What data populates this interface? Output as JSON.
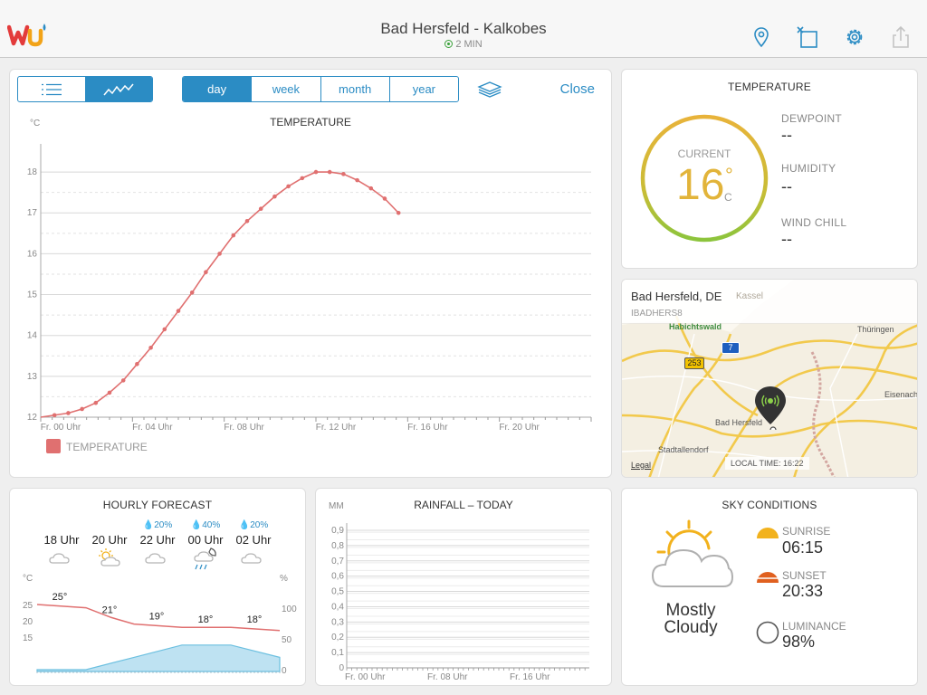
{
  "header": {
    "title": "Bad Hersfeld - Kalkobes",
    "updated": "2 MIN"
  },
  "toolbar": {
    "range_tabs": [
      "day",
      "week",
      "month",
      "year"
    ],
    "close_label": "Close"
  },
  "temperature_chart": {
    "title": "TEMPERATURE",
    "unit": "°C",
    "legend": "TEMPERATURE",
    "y_ticks": [
      "12",
      "13",
      "14",
      "15",
      "16",
      "17",
      "18"
    ],
    "x_ticks": [
      "Fr. 00 Uhr",
      "Fr. 04 Uhr",
      "Fr. 08 Uhr",
      "Fr. 12 Uhr",
      "Fr. 16 Uhr",
      "Fr. 20 Uhr"
    ],
    "color": "#e07070"
  },
  "chart_data": [
    {
      "type": "line",
      "title": "TEMPERATURE",
      "ylabel": "°C",
      "xlabel": "",
      "ylim": [
        12,
        18.6
      ],
      "xlim": [
        0,
        24
      ],
      "grid": true,
      "legend": "bottom-left",
      "series": [
        {
          "name": "TEMPERATURE",
          "x": [
            0.6,
            1.2,
            1.8,
            2.4,
            3.0,
            3.6,
            4.2,
            4.8,
            5.4,
            6.0,
            6.6,
            7.2,
            7.8,
            8.4,
            9.0,
            9.6,
            10.2,
            10.8,
            11.4,
            12.0,
            12.6,
            13.2,
            13.8,
            14.4,
            15.0,
            15.6
          ],
          "y": [
            12.05,
            12.1,
            12.2,
            12.35,
            12.6,
            12.9,
            13.3,
            13.7,
            14.15,
            14.6,
            15.05,
            15.55,
            16.0,
            16.45,
            16.8,
            17.1,
            17.4,
            17.65,
            17.85,
            18.0,
            18.0,
            17.95,
            17.8,
            17.6,
            17.35,
            17.0
          ]
        }
      ]
    },
    {
      "type": "line",
      "title": "HOURLY FORECAST",
      "ylabel": "°C",
      "series": [
        {
          "name": "temperature",
          "x": [
            "18 Uhr",
            "20 Uhr",
            "22 Uhr",
            "00 Uhr",
            "02 Uhr"
          ],
          "y": [
            25,
            21,
            19,
            18,
            18
          ]
        },
        {
          "name": "precipitation",
          "x": [
            "18 Uhr",
            "20 Uhr",
            "22 Uhr",
            "00 Uhr",
            "02 Uhr"
          ],
          "y": [
            0,
            0,
            20,
            40,
            20
          ]
        }
      ]
    },
    {
      "type": "bar",
      "title": "RAINFALL – TODAY",
      "ylabel": "MM",
      "ylim": [
        0,
        0.9
      ],
      "x": [
        "Fr. 00 Uhr",
        "Fr. 08 Uhr",
        "Fr. 16 Uhr"
      ],
      "values": []
    }
  ],
  "current": {
    "title": "TEMPERATURE",
    "label": "CURRENT",
    "value": "16",
    "degree": "°",
    "unit": "C",
    "dewpoint_label": "DEWPOINT",
    "dewpoint": "--",
    "humidity_label": "HUMIDITY",
    "humidity": "--",
    "windchill_label": "WIND CHILL",
    "windchill": "--"
  },
  "map": {
    "location": "Bad Hersfeld, DE",
    "station_id": "IBADHERS8",
    "local_time": "LOCAL TIME: 16:22",
    "legal": "Legal",
    "places": [
      "Kassel",
      "Habichtswald",
      "Thüringen",
      "Eisenach",
      "Bad Hersfeld",
      "Stadtallendorf"
    ],
    "road_a": "7",
    "road_b": "253"
  },
  "hourly": {
    "title": "HOURLY FORECAST",
    "unit_left": "°C",
    "unit_right": "%",
    "hours": [
      {
        "time": "18 Uhr",
        "pop": "",
        "icon": "cloud-icon"
      },
      {
        "time": "20 Uhr",
        "pop": "",
        "icon": "partly-sunny-icon"
      },
      {
        "time": "22 Uhr",
        "pop": "20%",
        "icon": "cloud-icon"
      },
      {
        "time": "00 Uhr",
        "pop": "40%",
        "icon": "night-rain-icon"
      },
      {
        "time": "02 Uhr",
        "pop": "20%",
        "icon": "cloud-icon"
      }
    ],
    "temps": [
      "25°",
      "21°",
      "19°",
      "18°",
      "18°"
    ],
    "left_ticks": [
      "25",
      "20",
      "15"
    ],
    "right_ticks": [
      "100",
      "50",
      "0"
    ]
  },
  "rainfall": {
    "title": "RAINFALL – TODAY",
    "unit": "MM",
    "y_ticks": [
      "0",
      "0,1",
      "0,2",
      "0,3",
      "0,4",
      "0,5",
      "0,6",
      "0,7",
      "0,8",
      "0,9"
    ],
    "x_ticks": [
      "Fr. 00 Uhr",
      "Fr. 08 Uhr",
      "Fr. 16 Uhr"
    ]
  },
  "sky": {
    "title": "SKY CONDITIONS",
    "condition_line1": "Mostly",
    "condition_line2": "Cloudy",
    "sunrise_label": "SUNRISE",
    "sunrise": "06:15",
    "sunset_label": "SUNSET",
    "sunset": "20:33",
    "luminance_label": "LUMINANCE",
    "luminance": "98%"
  },
  "colors": {
    "accent": "#2b8cc4",
    "temp_line": "#e07070",
    "ring_start": "#e8b33a",
    "ring_end": "#8cc43c",
    "rain_fill": "#a8d8ee"
  }
}
